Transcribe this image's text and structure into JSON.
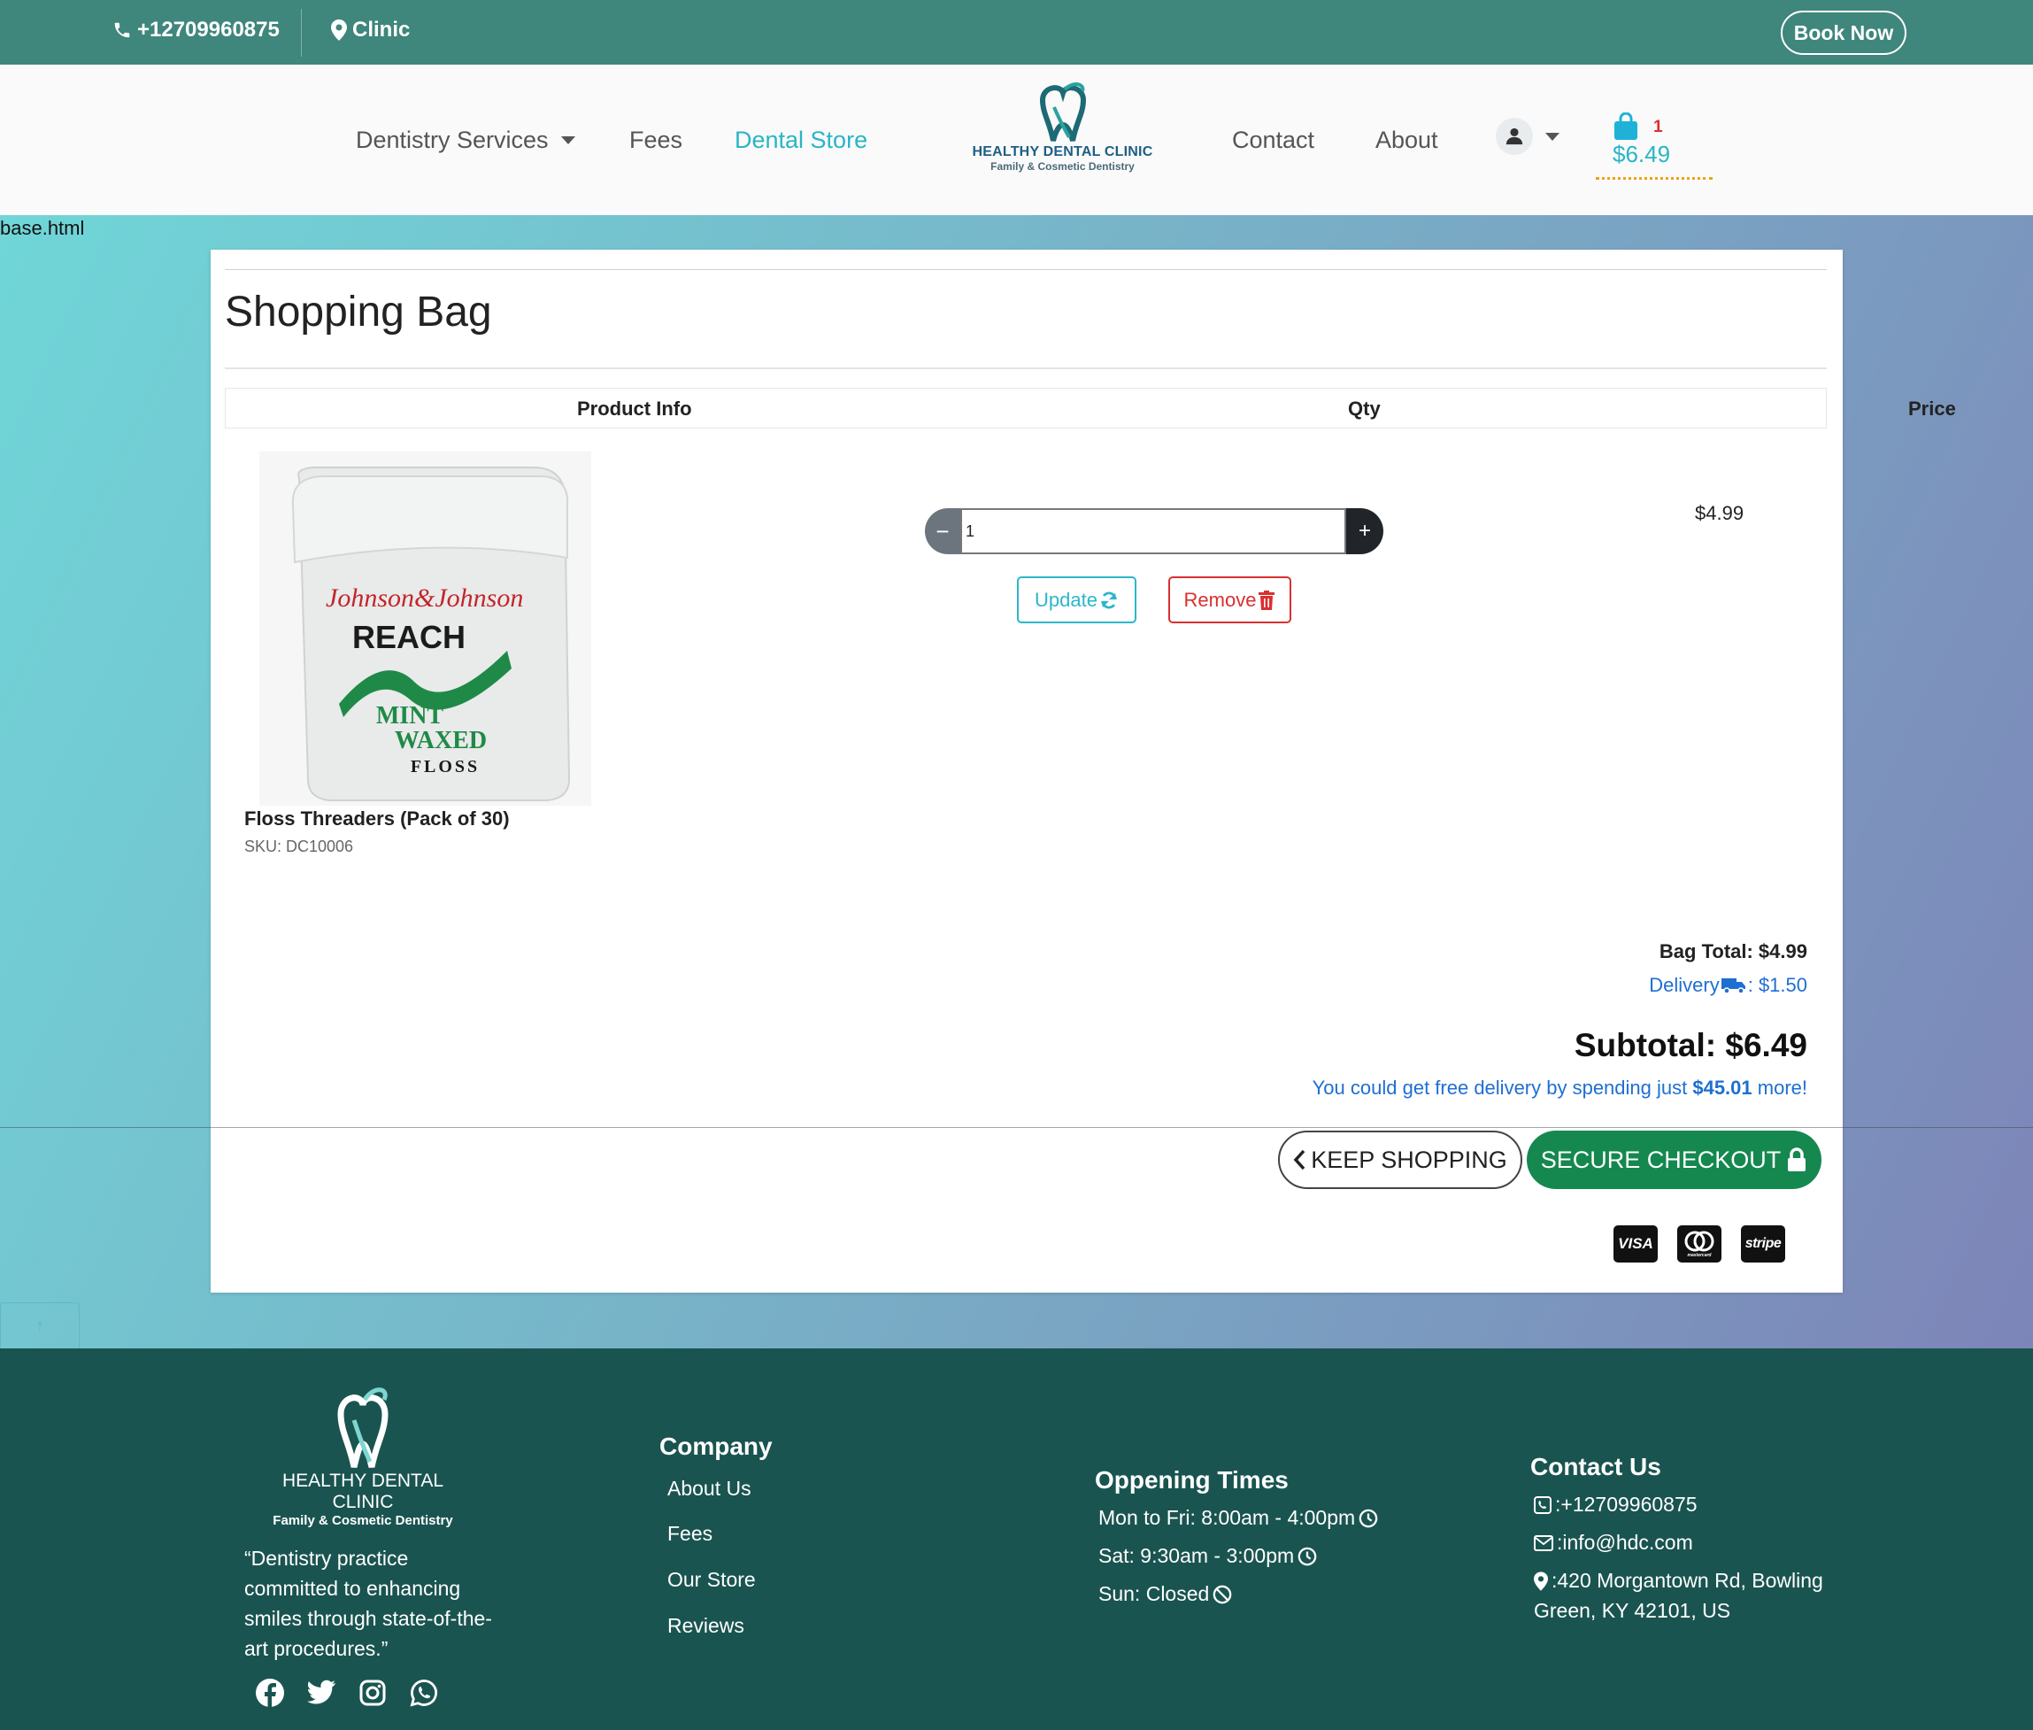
{
  "topbar": {
    "phone": "+12709960875",
    "clinic": "Clinic",
    "book_label": "Book Now"
  },
  "nav": {
    "services": "Dentistry Services",
    "fees": "Fees",
    "store": "Dental Store",
    "contact": "Contact",
    "about": "About",
    "logo_name": "HEALTHY DENTAL CLINIC",
    "logo_tagline": "Family & Cosmetic Dentistry",
    "cart_count": "1",
    "cart_total": "$6.49"
  },
  "base_label": "base.html",
  "bag": {
    "title": "Shopping Bag",
    "headers": {
      "product": "Product Info",
      "qty": "Qty",
      "price": "Price"
    },
    "item": {
      "name": "Floss Threaders (Pack of 30)",
      "sku": "SKU: DC10006",
      "qty": "1",
      "price": "$4.99",
      "image_brand": "Johnson&Johnson",
      "image_product": "REACH",
      "image_line1": "MINT",
      "image_line2": "WAXED",
      "image_line3": "FLOSS"
    },
    "update_label": "Update",
    "remove_label": "Remove",
    "bag_total": "Bag Total: $4.99",
    "delivery_label": "Delivery",
    "delivery_value": ": $1.50",
    "subtotal": "Subtotal: $6.49",
    "free_prefix": "You could get free delivery by spending just ",
    "free_amount": "$45.01",
    "free_suffix": " more!",
    "keep_shopping": "KEEP SHOPPING",
    "checkout": "SECURE CHECKOUT",
    "payment_methods": [
      "VISA",
      "mastercard",
      "stripe"
    ]
  },
  "footer": {
    "logo_name": "HEALTHY DENTAL CLINIC",
    "logo_tagline": "Family & Cosmetic Dentistry",
    "quote": "“Dentistry practice committed to enhancing smiles through state-of-the-art procedures.”",
    "company_title": "Company",
    "company_links": [
      "About Us",
      "Fees",
      "Our Store",
      "Reviews"
    ],
    "hours_title": "Oppening Times",
    "hours": [
      "Mon to Fri: 8:00am - 4:00pm",
      "Sat: 9:30am - 3:00pm",
      "Sun: Closed"
    ],
    "contact_title": "Contact Us",
    "contact_phone": ":+12709960875",
    "contact_email": ":info@hdc.com",
    "contact_address_1": ":420 Morgantown Rd, Bowling",
    "contact_address_2": "Green, KY 42101, US",
    "social": [
      "facebook-icon",
      "twitter-icon",
      "instagram-icon",
      "whatsapp-icon"
    ]
  },
  "colors": {
    "topbar": "#3f867c",
    "footer": "#1a5450",
    "accent": "#29b5c6",
    "danger": "#d9302f",
    "checkout": "#15884f",
    "link_blue": "#1f6fd1"
  }
}
